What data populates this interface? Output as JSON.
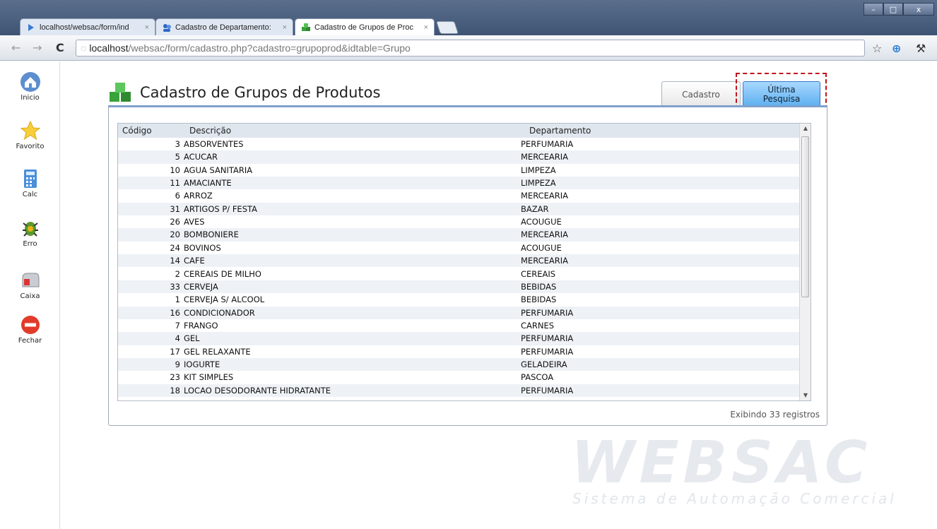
{
  "browser": {
    "tabs": [
      {
        "label": "localhost/websac/form/ind",
        "icon": "arrow-icon"
      },
      {
        "label": "Cadastro de Departamento:",
        "icon": "users-icon"
      },
      {
        "label": "Cadastro de Grupos de Proc",
        "icon": "cubes-icon"
      }
    ],
    "tab_close": "×",
    "url_host": "localhost",
    "url_path": "/websac/form/cadastro.php?cadastro=grupoprod&idtable=Grupo",
    "window_buttons": [
      "–",
      "□",
      "x"
    ]
  },
  "sidebar": {
    "items": [
      {
        "label": "Inicio",
        "icon": "home-icon"
      },
      {
        "label": "Favorito",
        "icon": "star-icon"
      },
      {
        "label": "Calc",
        "icon": "calculator-icon"
      },
      {
        "label": "Erro",
        "icon": "bug-icon"
      },
      {
        "label": "Caixa",
        "icon": "mailbox-icon"
      },
      {
        "label": "Fechar",
        "icon": "stop-icon"
      }
    ]
  },
  "page": {
    "title": "Cadastro de Grupos de Produtos",
    "tab_cadastro": "Cadastro",
    "tab_ultima_line1": "Última",
    "tab_ultima_line2": "Pesquisa"
  },
  "grid": {
    "headers": {
      "code": "Código",
      "desc": "Descrição",
      "dept": "Departamento"
    },
    "rows": [
      {
        "code": "3",
        "desc": "ABSORVENTES",
        "dept": "PERFUMARIA"
      },
      {
        "code": "5",
        "desc": "ACUCAR",
        "dept": "MERCEARIA"
      },
      {
        "code": "10",
        "desc": "AGUA SANITARIA",
        "dept": "LIMPEZA"
      },
      {
        "code": "11",
        "desc": "AMACIANTE",
        "dept": "LIMPEZA"
      },
      {
        "code": "6",
        "desc": "ARROZ",
        "dept": "MERCEARIA"
      },
      {
        "code": "31",
        "desc": "ARTIGOS P/ FESTA",
        "dept": "BAZAR"
      },
      {
        "code": "26",
        "desc": "AVES",
        "dept": "ACOUGUE"
      },
      {
        "code": "20",
        "desc": "BOMBONIERE",
        "dept": "MERCEARIA"
      },
      {
        "code": "24",
        "desc": "BOVINOS",
        "dept": "ACOUGUE"
      },
      {
        "code": "14",
        "desc": "CAFE",
        "dept": "MERCEARIA"
      },
      {
        "code": "2",
        "desc": "CEREAIS DE MILHO",
        "dept": "CEREAIS"
      },
      {
        "code": "33",
        "desc": "CERVEJA",
        "dept": "BEBIDAS"
      },
      {
        "code": "1",
        "desc": "CERVEJA S/ ALCOOL",
        "dept": "BEBIDAS"
      },
      {
        "code": "16",
        "desc": "CONDICIONADOR",
        "dept": "PERFUMARIA"
      },
      {
        "code": "7",
        "desc": "FRANGO",
        "dept": "CARNES"
      },
      {
        "code": "4",
        "desc": "GEL",
        "dept": "PERFUMARIA"
      },
      {
        "code": "17",
        "desc": "GEL RELAXANTE",
        "dept": "PERFUMARIA"
      },
      {
        "code": "9",
        "desc": "IOGURTE",
        "dept": "GELADEIRA"
      },
      {
        "code": "23",
        "desc": "KIT SIMPLES",
        "dept": "PASCOA"
      },
      {
        "code": "18",
        "desc": "LOCAO DESODORANTE HIDRATANTE",
        "dept": "PERFUMARIA"
      }
    ],
    "footer": "Exibindo 33 registros"
  },
  "watermark": {
    "logo": "WEBSAC",
    "subtitle": "Sistema de Automação Comercial"
  },
  "colors": {
    "accent": "#5aaeef",
    "highlight": "#c0141a"
  }
}
